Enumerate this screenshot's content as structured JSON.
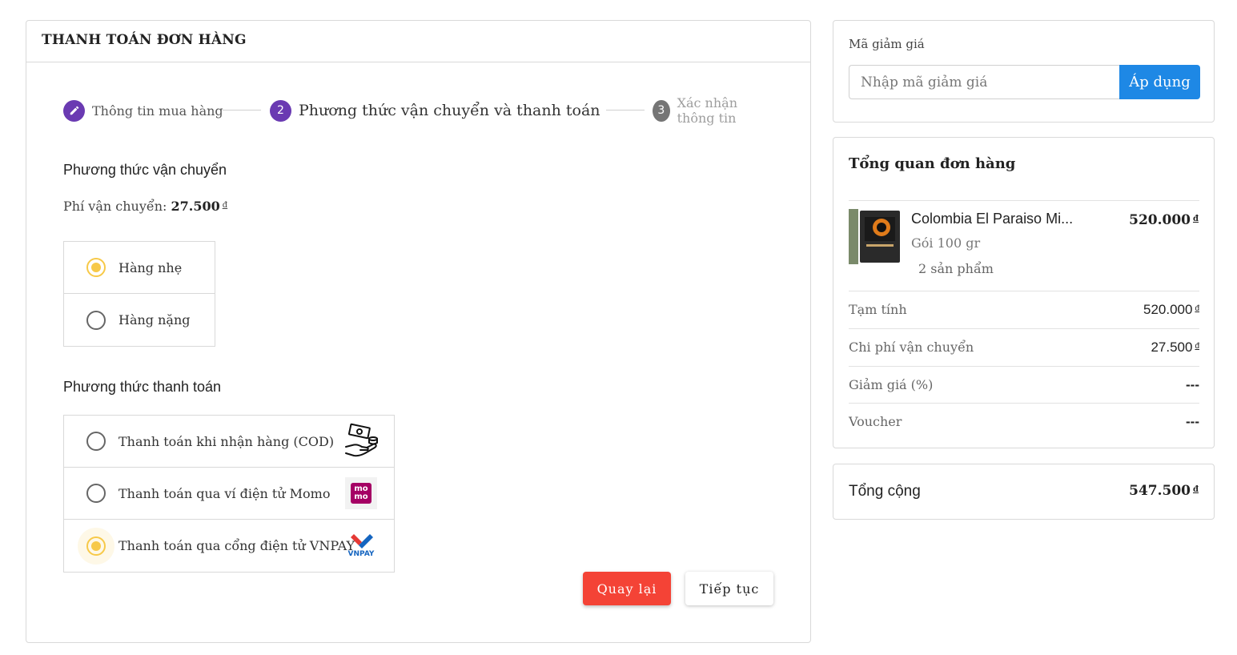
{
  "checkout": {
    "title": "THANH TOÁN ĐƠN HÀNG",
    "steps": [
      {
        "number": "",
        "label": "Thông tin mua hàng",
        "state": "done"
      },
      {
        "number": "2",
        "label": "Phương thức vận chuyển và thanh toán",
        "state": "active"
      },
      {
        "number": "3",
        "label": "Xác nhận thông tin",
        "state": "pending"
      }
    ],
    "shipping": {
      "title": "Phương thức vận chuyển",
      "fee_label": "Phí vận chuyển:",
      "fee_value": "27.500",
      "currency": "đ",
      "options": [
        {
          "label": "Hàng nhẹ",
          "checked": true
        },
        {
          "label": "Hàng nặng",
          "checked": false
        }
      ]
    },
    "payment": {
      "title": "Phương thức thanh toán",
      "options": [
        {
          "label": "Thanh toán khi nhận hàng (COD)",
          "checked": false,
          "icon": "cash-hand-icon"
        },
        {
          "label": "Thanh toán qua ví điện tử Momo",
          "checked": false,
          "icon": "momo-icon",
          "icon_text": "mo\nmo"
        },
        {
          "label": "Thanh toán qua cổng điện tử VNPAY",
          "checked": true,
          "icon": "vnpay-icon",
          "icon_text": "VNPAY"
        }
      ]
    },
    "buttons": {
      "back": "Quay lại",
      "next": "Tiếp tục"
    }
  },
  "coupon": {
    "label": "Mã giảm giá",
    "placeholder": "Nhập mã giảm giá",
    "apply": "Áp dụng"
  },
  "summary": {
    "title": "Tổng quan đơn hàng",
    "product": {
      "name": "Colombia El Paraiso Mi...",
      "variant": "Gói 100 gr",
      "quantity": "2 sản phẩm",
      "price": "520.000"
    },
    "rows": [
      {
        "label": "Tạm tính",
        "value": "520.000",
        "currency": "đ"
      },
      {
        "label": "Chi phí vận chuyển",
        "value": "27.500",
        "currency": "đ"
      },
      {
        "label": "Giảm giá (%)",
        "value": "---",
        "currency": ""
      },
      {
        "label": "Voucher",
        "value": "---",
        "currency": ""
      }
    ],
    "currency": "đ"
  },
  "total": {
    "label": "Tổng cộng",
    "value": "547.500",
    "currency": "đ"
  },
  "colors": {
    "step_active": "#6a3ab2",
    "radio_checked": "#f7c948",
    "back_button": "#f44336",
    "apply_button": "#1e88e5",
    "momo": "#a50064"
  }
}
